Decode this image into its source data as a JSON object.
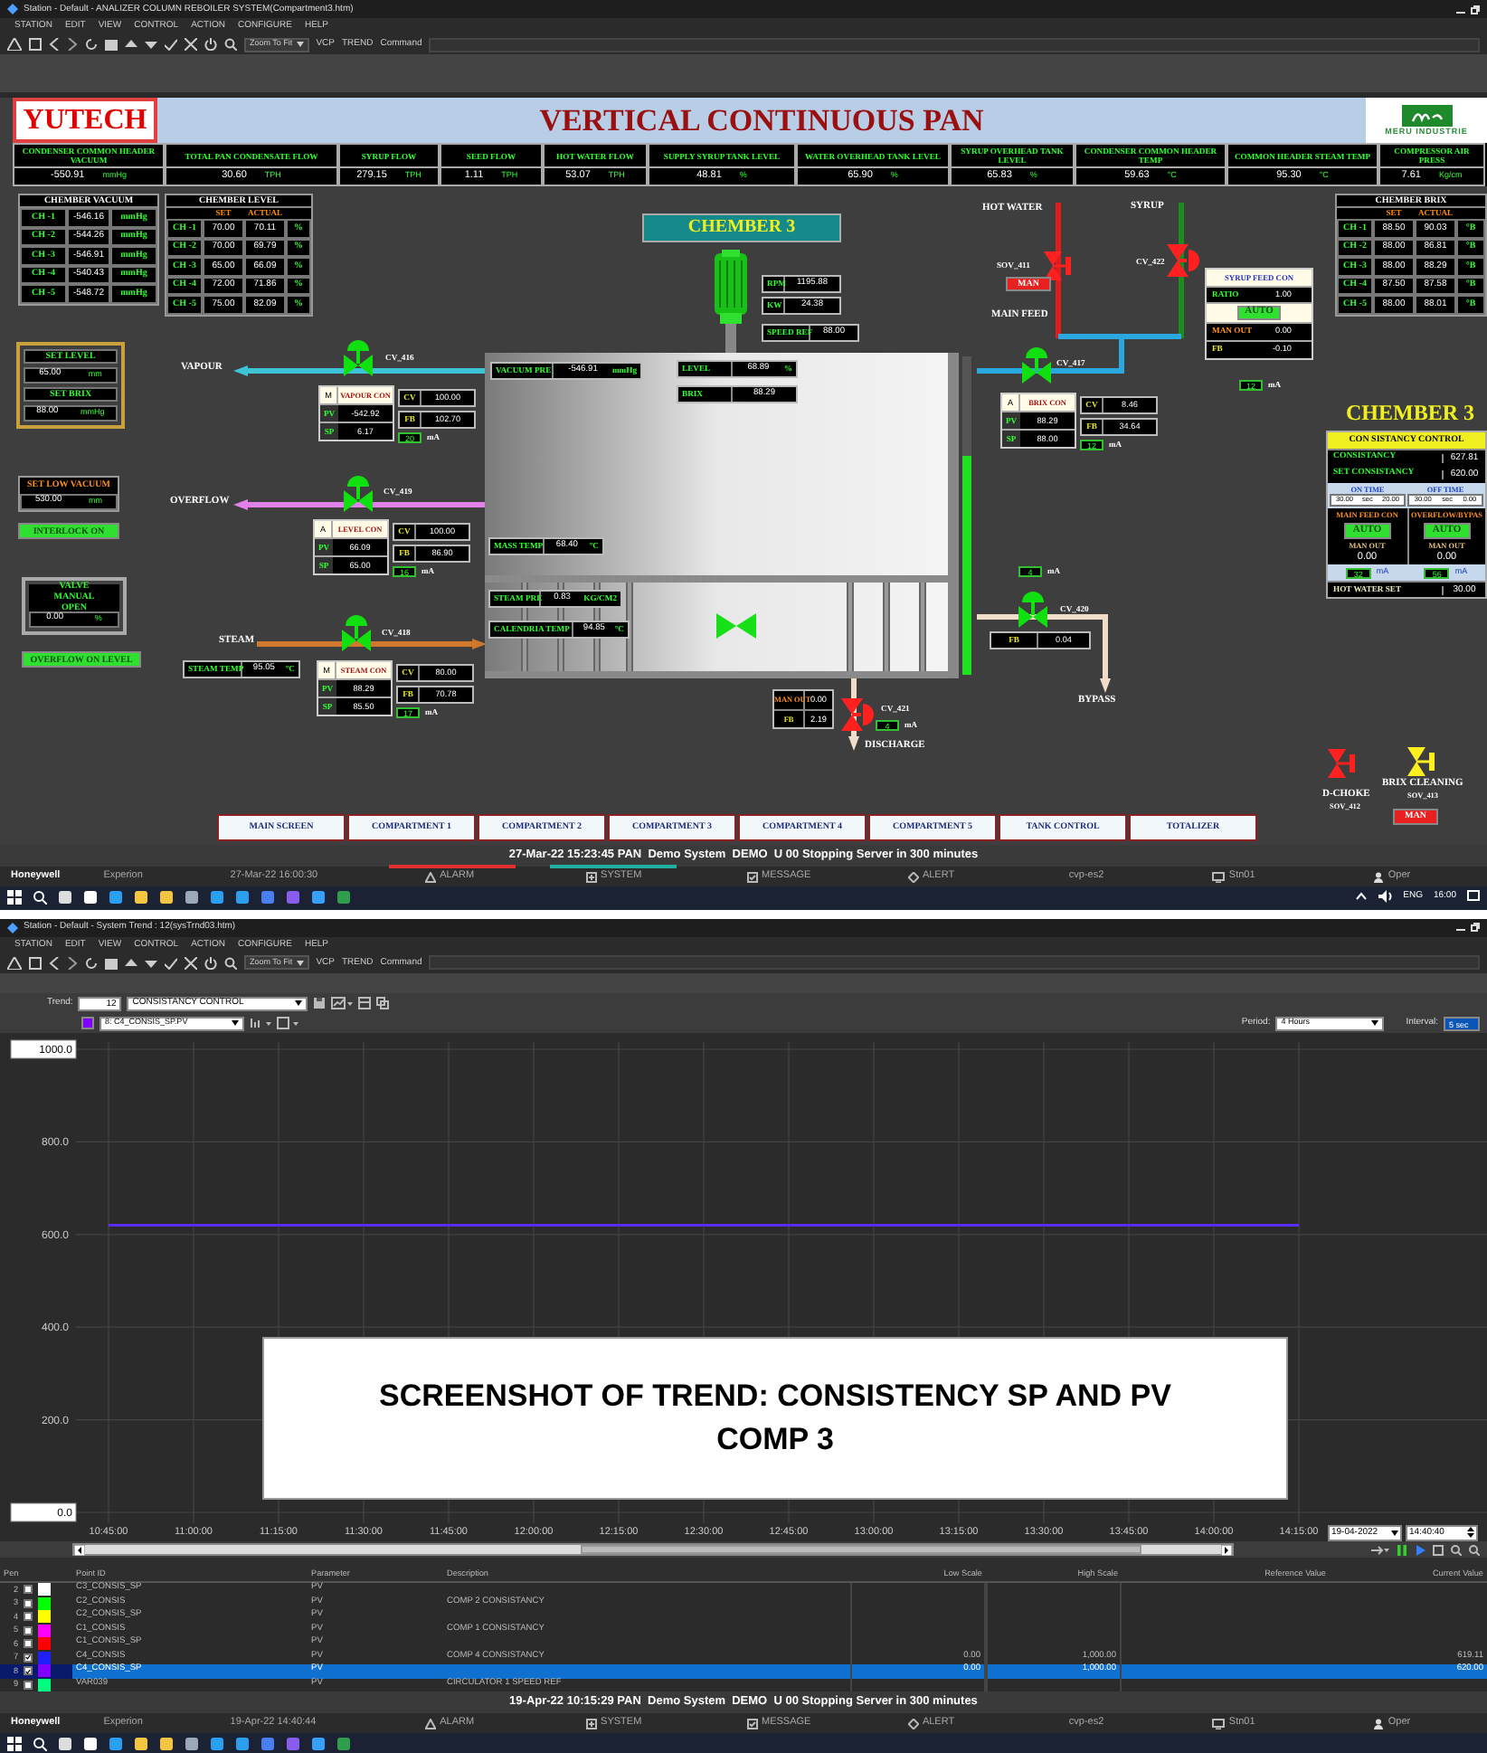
{
  "hmi_window": {
    "title": "Station - Default - ANALIZER COLUMN REBOILER SYSTEM(Compartment3.htm)",
    "menu": [
      "STATION",
      "EDIT",
      "VIEW",
      "CONTROL",
      "ACTION",
      "CONFIGURE",
      "HELP"
    ],
    "toolbar": {
      "zoom": "Zoom To Fit",
      "links": [
        "VCP",
        "TREND",
        "Command"
      ]
    },
    "header": {
      "logo": "YUTECH",
      "title": "VERTICAL CONTINUOUS PAN",
      "brand": "MERU INDUSTRIE"
    },
    "summary": [
      {
        "label": "CONDENSER COMMON HEADER VACUUM",
        "value": "-550.91",
        "unit": "mmHg"
      },
      {
        "label": "TOTAL PAN CONDENSATE FLOW",
        "value": "30.60",
        "unit": "TPH"
      },
      {
        "label": "SYRUP FLOW",
        "value": "279.15",
        "unit": "TPH"
      },
      {
        "label": "SEED FLOW",
        "value": "1.11",
        "unit": "TPH"
      },
      {
        "label": "HOT WATER FLOW",
        "value": "53.07",
        "unit": "TPH"
      },
      {
        "label": "SUPPLY SYRUP TANK LEVEL",
        "value": "48.81",
        "unit": "%"
      },
      {
        "label": "WATER OVERHEAD TANK LEVEL",
        "value": "65.90",
        "unit": "%"
      },
      {
        "label": "SYRUP OVERHEAD TANK LEVEL",
        "value": "65.83",
        "unit": "%"
      },
      {
        "label": "CONDENSER COMMON HEADER TEMP",
        "value": "59.63",
        "unit": "°C"
      },
      {
        "label": "COMMON HEADER STEAM TEMP",
        "value": "95.30",
        "unit": "°C"
      },
      {
        "label": "COMPRESSOR AIR PRESS",
        "value": "7.61",
        "unit": "Kg/cm"
      }
    ],
    "vacuum_table": {
      "title": "CHEMBER VACUUM",
      "rows": [
        {
          "name": "CH -1",
          "value": "-546.16",
          "unit": "mmHg"
        },
        {
          "name": "CH -2",
          "value": "-544.26",
          "unit": "mmHg"
        },
        {
          "name": "CH -3",
          "value": "-546.91",
          "unit": "mmHg"
        },
        {
          "name": "CH -4",
          "value": "-540.43",
          "unit": "mmHg"
        },
        {
          "name": "CH -5",
          "value": "-548.72",
          "unit": "mmHg"
        }
      ]
    },
    "level_table": {
      "title": "CHEMBER LEVEL",
      "headers": [
        "SET",
        "ACTUAL"
      ],
      "rows": [
        {
          "name": "CH -1",
          "set": "70.00",
          "actual": "70.11",
          "unit": "%"
        },
        {
          "name": "CH -2",
          "set": "70.00",
          "actual": "69.79",
          "unit": "%"
        },
        {
          "name": "CH -3",
          "set": "65.00",
          "actual": "66.09",
          "unit": "%"
        },
        {
          "name": "CH -4",
          "set": "72.00",
          "actual": "71.86",
          "unit": "%"
        },
        {
          "name": "CH -5",
          "set": "75.00",
          "actual": "82.09",
          "unit": "%"
        }
      ]
    },
    "brix_table": {
      "title": "CHEMBER BRIX",
      "headers": [
        "SET",
        "ACTUAL"
      ],
      "rows": [
        {
          "name": "CH -1",
          "set": "88.50",
          "actual": "90.03",
          "unit": "°B"
        },
        {
          "name": "CH -2",
          "set": "88.00",
          "actual": "86.81",
          "unit": "°B"
        },
        {
          "name": "CH -3",
          "set": "88.00",
          "actual": "88.29",
          "unit": "°B"
        },
        {
          "name": "CH -4",
          "set": "87.50",
          "actual": "87.58",
          "unit": "°B"
        },
        {
          "name": "CH -5",
          "set": "88.00",
          "actual": "88.01",
          "unit": "°B"
        }
      ]
    },
    "setpoints": [
      {
        "label": "SET LEVEL",
        "value": "65.00",
        "unit": "mm"
      },
      {
        "label": "SET BRIX",
        "value": "88.00",
        "unit": "mmHg"
      }
    ],
    "low_vacuum": {
      "label": "SET LOW VACUUM",
      "value": "530.00",
      "unit": "mm"
    },
    "indicators": [
      {
        "label": "INTERLOCK ON",
        "on": true
      },
      {
        "label": "OVERFLOW ON LEVEL",
        "on": true
      }
    ],
    "valve_manual": {
      "label": "VALVE MANUAL OPEN",
      "value": "0.00",
      "unit": "%"
    },
    "chamber_title": "CHEMBER 3",
    "motor": [
      {
        "label": "RPM",
        "value": "1195.88"
      },
      {
        "label": "KW",
        "value": "24.38"
      },
      {
        "label": "SPEED REF",
        "value": "88.00"
      }
    ],
    "vessel": {
      "level": 0.69
    },
    "readouts": [
      {
        "label": "VACUUM PRE",
        "value": "-546.91",
        "unit": "mmHg"
      },
      {
        "label": "LEVEL",
        "value": "68.89",
        "unit": "%"
      },
      {
        "label": "BRIX",
        "value": "88.29"
      },
      {
        "label": "MASS TEMP",
        "value": "68.40",
        "unit": "°C"
      },
      {
        "label": "STEAM PRE",
        "value": "0.83",
        "unit": "KG/CM2"
      },
      {
        "label": "CALENDRIA TEMP",
        "value": "94.85",
        "unit": "°C"
      },
      {
        "label": "STEAM TEMP",
        "value": "95.05",
        "unit": "°C"
      }
    ],
    "pipes": [
      {
        "label": "VAPOUR",
        "color": "#3cc4d6"
      },
      {
        "label": "OVERFLOW",
        "color": "#e080e8"
      },
      {
        "label": "STEAM",
        "color": "#d0782c"
      },
      {
        "label": "HOT WATER",
        "color": "#e01c1c"
      },
      {
        "label": "SYRUP",
        "color": "#1c8c1c"
      },
      {
        "label": "MAIN FEED",
        "color": "#2aa8e0"
      },
      {
        "label": "BYPASS",
        "color": "#f0dcc8"
      },
      {
        "label": "DISCHARGE",
        "color": "#f0dcc8"
      }
    ],
    "valves": [
      {
        "tag": "CV_416",
        "kind": "top",
        "color": "#10e010"
      },
      {
        "tag": "CV_419",
        "kind": "top",
        "color": "#10e010"
      },
      {
        "tag": "CV_418",
        "kind": "top",
        "color": "#10e010"
      },
      {
        "tag": "CV_417",
        "kind": "top",
        "color": "#10e010"
      },
      {
        "tag": "CV_420",
        "kind": "top",
        "color": "#10e010"
      },
      {
        "tag": "SOV_411",
        "kind": "solenoid",
        "color": "#ff2020",
        "button": "MAN"
      },
      {
        "tag": "CV_422",
        "kind": "side",
        "color": "#ff2020"
      },
      {
        "tag": "CV_421",
        "kind": "side",
        "color": "#ff2020"
      }
    ],
    "controllers": [
      {
        "mode": "M",
        "title": "VAPOUR CON",
        "inputs": [
          {
            "label": "PV",
            "value": "-542.92"
          },
          {
            "label": "SP",
            "value": "6.17"
          }
        ],
        "outputs": [
          {
            "label": "CV",
            "value": "100.00"
          },
          {
            "label": "FB",
            "value": "102.70"
          }
        ],
        "current": {
          "value": "20",
          "unit": "mA"
        }
      },
      {
        "mode": "A",
        "title": "LEVEL CON",
        "inputs": [
          {
            "label": "PV",
            "value": "66.09"
          },
          {
            "label": "SP",
            "value": "65.00"
          }
        ],
        "outputs": [
          {
            "label": "CV",
            "value": "100.00"
          },
          {
            "label": "FB",
            "value": "86.90"
          }
        ],
        "current": {
          "value": "16",
          "unit": "mA"
        }
      },
      {
        "mode": "M",
        "title": "STEAM CON",
        "inputs": [
          {
            "label": "PV",
            "value": "88.29"
          },
          {
            "label": "SP",
            "value": "85.50"
          }
        ],
        "outputs": [
          {
            "label": "CV",
            "value": "80.00"
          },
          {
            "label": "FB",
            "value": "70.78"
          }
        ],
        "current": {
          "value": "17",
          "unit": "mA"
        }
      },
      {
        "mode": "A",
        "title": "BRIX CON",
        "inputs": [
          {
            "label": "PV",
            "value": "88.29"
          },
          {
            "label": "SP",
            "value": "88.00"
          }
        ],
        "outputs": [
          {
            "label": "CV",
            "value": "8.46"
          },
          {
            "label": "FB",
            "value": "34.64"
          }
        ],
        "current": {
          "value": "12",
          "unit": "mA"
        }
      }
    ],
    "feed_controller": {
      "title": "SYRUP FEED CON",
      "ratio": {
        "label": "RATIO",
        "value": "1.00"
      },
      "mode": "AUTO",
      "auto": true,
      "outputs": [
        {
          "label": "MAN OUT",
          "value": "0.00"
        },
        {
          "label": "FB",
          "value": "-0.10"
        }
      ],
      "current": {
        "value": "12",
        "unit": "mA"
      }
    },
    "bypass": {
      "current": {
        "value": "4",
        "unit": "mA"
      },
      "feedback": {
        "label": "FB",
        "value": "0.04"
      }
    },
    "discharge": {
      "outputs": [
        {
          "label": "MAN OUT",
          "value": "0.00"
        },
        {
          "label": "FB",
          "value": "2.19"
        }
      ],
      "current": {
        "value": "4",
        "unit": "mA"
      }
    },
    "consistency": {
      "title": "CHEMBER 3",
      "heading": "CON SISTANCY CONTROL",
      "rows": [
        {
          "label": "CONSISTANCY",
          "value": "627.81"
        },
        {
          "label": "SET CONSISTANCY",
          "value": "620.00"
        }
      ],
      "timers": [
        {
          "label": "ON TIME",
          "cells": [
            "30.00",
            "sec",
            "20.00"
          ]
        },
        {
          "label": "OFF TIME",
          "cells": [
            "30.00",
            "sec",
            "0.00"
          ]
        }
      ],
      "loops": [
        {
          "title": "MAIN FEED CON",
          "mode": "AUTO",
          "auto": true,
          "out_label": "MAN OUT",
          "out": "0.00",
          "current": "32",
          "unit": "mA"
        },
        {
          "title": "OVERFLOW/BYPAS",
          "mode": "AUTO",
          "auto": true,
          "out_label": "MAN OUT",
          "out": "0.00",
          "current": "56",
          "unit": "mA"
        }
      ],
      "hot_water": {
        "label": "HOT WATER SET",
        "value": "30.00"
      }
    },
    "solenoids": [
      {
        "name": "D-CHOKE",
        "tag": "SOV_412",
        "color": "#ff2020"
      },
      {
        "name": "BRIX CLEANING",
        "tag": "SOV_413",
        "color": "#ffee20",
        "button": "MAN"
      }
    ],
    "nav": [
      "MAIN SCREEN",
      "COMPARTMENT 1",
      "COMPARTMENT 2",
      "COMPARTMENT 3",
      "COMPARTMENT 4",
      "COMPARTMENT 5",
      "TANK CONTROL",
      "TOTALIZER"
    ],
    "message": "27-Mar-22 15:23:45 PAN  Demo System  DEMO  U 00 Stopping Server in 300 minutes",
    "status_bar": [
      {
        "label": "Honeywell",
        "kind": "brand"
      },
      {
        "label": "Experion",
        "kind": "text"
      },
      {
        "label": "27-Mar-22 16:00:30",
        "kind": "text"
      },
      {
        "label": "ALARM",
        "kind": "alarm",
        "color": "#e03030"
      },
      {
        "label": "SYSTEM",
        "kind": "system",
        "color": "#20b0a0"
      },
      {
        "label": "MESSAGE",
        "kind": "message"
      },
      {
        "label": "ALERT",
        "kind": "alert"
      },
      {
        "label": "cvp-es2",
        "kind": "text"
      },
      {
        "label": "Stn01",
        "kind": "station"
      },
      {
        "label": "Oper",
        "kind": "user"
      }
    ],
    "taskbar": {
      "language": "ENG",
      "time": "16:00"
    }
  },
  "trend_window": {
    "title": "Station - Default - System Trend : 12(sysTrnd03.htm)",
    "menu": [
      "STATION",
      "EDIT",
      "VIEW",
      "CONTROL",
      "ACTION",
      "CONFIGURE",
      "HELP"
    ],
    "toolbar": {
      "zoom": "Zoom To Fit",
      "links": [
        "VCP",
        "TREND",
        "Command"
      ]
    },
    "trend": {
      "label": "Trend:",
      "number": "12",
      "name": "CONSISTANCY CONTROL"
    },
    "pen_selector": {
      "color": "#8000ff",
      "value": "8: C4_CONSIS_SP.PV"
    },
    "period": {
      "label": "Period:",
      "value": "4 Hours"
    },
    "interval": {
      "label": "Interval:",
      "value": "5 sec"
    },
    "chart_data": {
      "type": "line",
      "x": [
        "10:45:00",
        "11:00:00",
        "11:15:00",
        "11:30:00",
        "11:45:00",
        "12:00:00",
        "12:15:00",
        "12:30:00",
        "12:45:00",
        "13:00:00",
        "13:15:00",
        "13:30:00",
        "13:45:00",
        "14:00:00",
        "14:15:00"
      ],
      "ylim": [
        0,
        1000
      ],
      "yticks": [
        {
          "value": 0,
          "label": "0.0"
        },
        {
          "value": 200,
          "label": "200.0"
        },
        {
          "value": 400,
          "label": "400.0"
        },
        {
          "value": 600,
          "label": "600.0"
        },
        {
          "value": 800,
          "label": "800.0"
        },
        {
          "value": 1000,
          "label": "1000.0"
        }
      ],
      "grid": true,
      "series": [
        {
          "color": "#5a2cff",
          "values": [
            620,
            620,
            620,
            620,
            620,
            620,
            620,
            620,
            620,
            620,
            620,
            620,
            620,
            620,
            620
          ]
        }
      ]
    },
    "date": "19-04-2022",
    "time": "14:40:40",
    "caption": "SCREENSHOT OF TREND: CONSISTENCY SP AND PV COMP 3",
    "table": {
      "columns": [
        "Pen",
        "Point ID",
        "Parameter",
        "Description",
        "Low Scale",
        "High Scale",
        "Reference Value",
        "Current Value"
      ],
      "rows": [
        {
          "number": "2",
          "checked": false,
          "selected": false,
          "color": "#ffffff",
          "point": "C3_CONSIS_SP",
          "parameter": "PV"
        },
        {
          "number": "3",
          "checked": false,
          "selected": false,
          "color": "#00ff00",
          "point": "C2_CONSIS",
          "parameter": "PV",
          "description": "COMP 2 CONSISTANCY"
        },
        {
          "number": "4",
          "checked": false,
          "selected": false,
          "color": "#ffff00",
          "point": "C2_CONSIS_SP",
          "parameter": "PV"
        },
        {
          "number": "5",
          "checked": false,
          "selected": false,
          "color": "#ff00ff",
          "point": "C1_CONSIS",
          "parameter": "PV",
          "description": "COMP 1 CONSISTANCY"
        },
        {
          "number": "6",
          "checked": false,
          "selected": false,
          "color": "#ff0000",
          "point": "C1_CONSIS_SP",
          "parameter": "PV"
        },
        {
          "number": "7",
          "checked": true,
          "selected": false,
          "color": "#2020ff",
          "point": "C4_CONSIS",
          "parameter": "PV",
          "description": "COMP 4 CONSISTANCY",
          "low": "0.00",
          "high": "1,000.00",
          "current": "619.11"
        },
        {
          "number": "8",
          "checked": true,
          "selected": true,
          "color": "#8000ff",
          "point": "C4_CONSIS_SP",
          "parameter": "PV",
          "low": "0.00",
          "high": "1,000.00",
          "current": "620.00"
        },
        {
          "number": "9",
          "checked": false,
          "selected": false,
          "color": "#00ff80",
          "point": "VAR039",
          "parameter": "PV",
          "description": "CIRCULATOR 1 SPEED REF"
        }
      ]
    },
    "message": "19-Apr-22 10:15:29 PAN  Demo System  DEMO  U 00 Stopping Server in 300 minutes",
    "status_bar": [
      {
        "label": "Honeywell",
        "kind": "brand"
      },
      {
        "label": "Experion",
        "kind": "text"
      },
      {
        "label": "19-Apr-22 14:40:44",
        "kind": "text"
      },
      {
        "label": "ALARM",
        "kind": "alarm"
      },
      {
        "label": "SYSTEM",
        "kind": "system"
      },
      {
        "label": "MESSAGE",
        "kind": "message"
      },
      {
        "label": "ALERT",
        "kind": "alert"
      },
      {
        "label": "cvp-es2",
        "kind": "text"
      },
      {
        "label": "Stn01",
        "kind": "station"
      },
      {
        "label": "Oper",
        "kind": "user"
      }
    ]
  }
}
